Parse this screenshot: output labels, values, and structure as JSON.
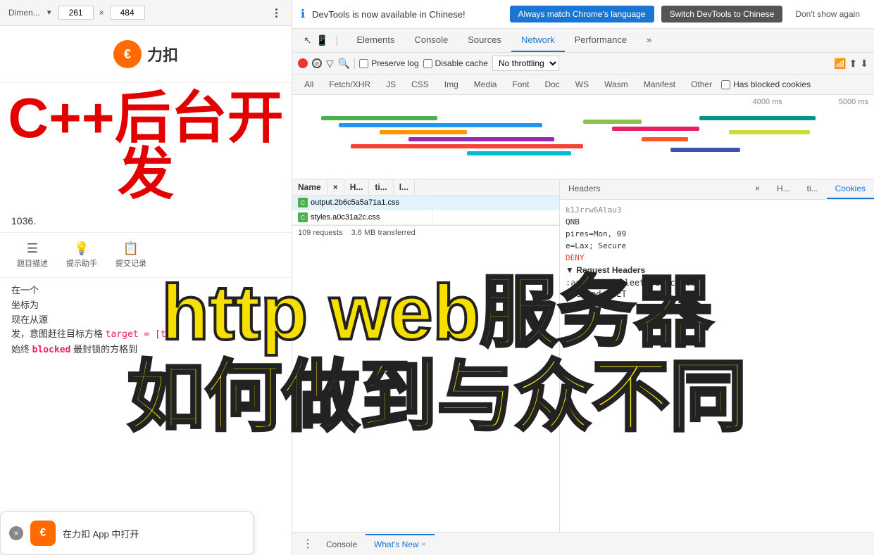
{
  "left": {
    "topbar": {
      "dim_label": "Dimen...",
      "width": "261",
      "height": "484",
      "x_separator": "×"
    },
    "logo": {
      "icon_char": "€",
      "text": "力扣"
    },
    "main_title": "C++后台开发",
    "sub_info": "1036.",
    "tabs": [
      {
        "label": "题目描述",
        "icon": "☰"
      },
      {
        "label": "提示助手",
        "icon": "💡"
      },
      {
        "label": "提交记录",
        "icon": "📋"
      }
    ],
    "content1": "在一个",
    "content2": "坐标为",
    "content3": "现在从源",
    "content4": "发，意图赶往目标方格",
    "code1": "target = [t",
    "content5": "始终",
    "blocked_text": "blocked",
    "content6": "最封锁的方格到",
    "notification": {
      "text": "在力扣 App 中打开"
    }
  },
  "devtools": {
    "notification": {
      "message": "DevTools is now available in Chinese!",
      "btn1": "Always match Chrome's language",
      "btn2": "Switch DevTools to Chinese",
      "btn3": "Don't show again"
    },
    "tabs": [
      {
        "label": "Elements"
      },
      {
        "label": "Console"
      },
      {
        "label": "Sources"
      },
      {
        "label": "Network",
        "active": true
      },
      {
        "label": "Performance"
      },
      {
        "label": "»"
      }
    ],
    "toolbar": {
      "preserve_log": "Preserve log",
      "disable_cache": "Disable cache",
      "no_throttling": "No throttling"
    },
    "filter_buttons": [
      {
        "label": "All",
        "active": false
      },
      {
        "label": "Fetch/XHR",
        "active": false
      },
      {
        "label": "JS",
        "active": false
      },
      {
        "label": "CSS",
        "active": false
      },
      {
        "label": "Img",
        "active": false
      },
      {
        "label": "Media",
        "active": false
      },
      {
        "label": "Font",
        "active": false
      },
      {
        "label": "Doc",
        "active": false
      },
      {
        "label": "WS",
        "active": false
      },
      {
        "label": "Wasm",
        "active": false
      },
      {
        "label": "Manifest",
        "active": false
      },
      {
        "label": "Other",
        "active": false
      },
      {
        "label": "Has blocked cookies",
        "active": false,
        "is_checkbox": true
      }
    ],
    "waterfall": {
      "label1": "4000 ms",
      "label2": "5000 ms"
    },
    "network_list_headers": [
      "Name",
      "×",
      "H...",
      "ti...",
      "l..."
    ],
    "network_rows": [
      {
        "name": "output.2b6c5a5a71a1.css",
        "icon_color": "#4caf50",
        "selected": true
      },
      {
        "name": "styles.a0c31a2c.css",
        "icon_color": "#4caf50",
        "selected": false
      }
    ],
    "stats": {
      "requests": "109 requests",
      "transferred": "3.6 MB transferred"
    },
    "detail_tabs": [
      {
        "label": "Headers",
        "active": false
      },
      {
        "label": "×",
        "is_close": true
      },
      {
        "label": "H...",
        "active": false
      },
      {
        "label": "ti...",
        "active": false
      },
      {
        "label": "Cookies",
        "active": true
      }
    ],
    "request_headers": {
      "title": "▼ Request Headers",
      "authority": "leetcode-cn.com",
      "method": ":method: GET"
    },
    "cookies_header": "Cookies",
    "cookie_content": [
      {
        "key": ":authority:",
        "val": "leetcode-cn.com"
      },
      {
        "key": ":method:",
        "val": "GET"
      }
    ],
    "bottom_tabs": [
      {
        "label": "Console",
        "active": false
      },
      {
        "label": "What's New",
        "active": true,
        "closeable": true
      }
    ]
  },
  "overlay": {
    "line1": "http web服务器",
    "line2": "如何做到与众不同"
  }
}
